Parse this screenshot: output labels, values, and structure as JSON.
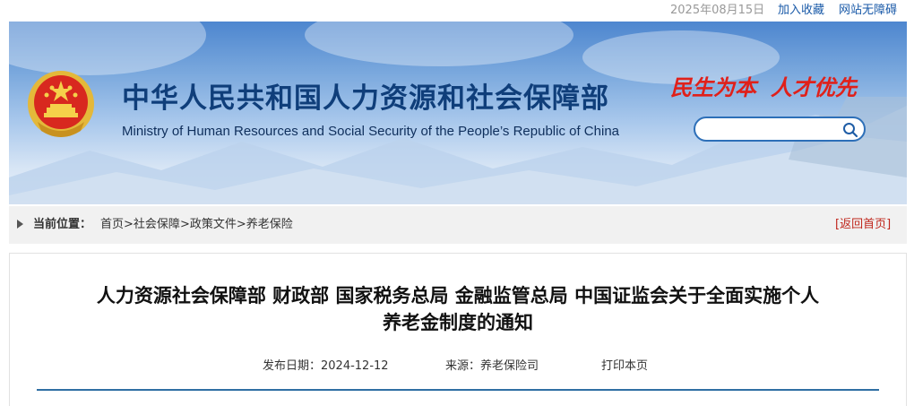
{
  "topbar": {
    "date": "2025年08月15日",
    "add_favorite": "加入收藏",
    "accessibility": "网站无障碍"
  },
  "banner": {
    "title_cn": "中华人民共和国人力资源和社会保障部",
    "title_en": "Ministry of Human Resources and Social Security of the People’s Republic of China",
    "slogan_left": "民生为本",
    "slogan_right": "人才优先",
    "emblem_icon": "national-emblem-icon",
    "search_icon": "search-icon",
    "search_placeholder": "",
    "colors": {
      "title": "#0f3e7a",
      "slogan": "#e0201a",
      "banner_top": "#4d86cf"
    }
  },
  "breadcrumb": {
    "label": "当前位置：",
    "items": [
      "首页",
      "社会保障",
      "政策文件",
      "养老保险"
    ],
    "separator": ">",
    "back_home": "[返回首页]"
  },
  "article": {
    "title_line1": "人力资源社会保障部 财政部 国家税务总局 金融监管总局 中国证监会关于全面实施个人",
    "title_line2": "养老金制度的通知",
    "publish_label": "发布日期：",
    "publish_date": "2024-12-12",
    "source_label": "来源：",
    "source_value": "养老保险司",
    "print_label": "打印本页"
  }
}
